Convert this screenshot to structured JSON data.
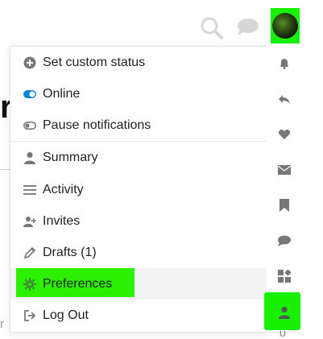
{
  "background": {
    "partial_heading": "r",
    "partial_text": "r"
  },
  "header": {
    "search_icon": "search-icon",
    "chat_icon": "chat-icon",
    "avatar_icon": "user-avatar"
  },
  "menu": {
    "status_items": [
      {
        "label": "Set custom status",
        "icon": "plus-circle-icon"
      },
      {
        "label": "Online",
        "icon": "toggle-on-icon"
      },
      {
        "label": "Pause notifications",
        "icon": "toggle-off-icon"
      }
    ],
    "nav_items": [
      {
        "label": "Summary",
        "icon": "user-icon"
      },
      {
        "label": "Activity",
        "icon": "list-icon"
      },
      {
        "label": "Invites",
        "icon": "user-plus-icon"
      },
      {
        "label": "Drafts (1)",
        "icon": "pencil-icon"
      },
      {
        "label": "Preferences",
        "icon": "gear-icon"
      },
      {
        "label": "Log Out",
        "icon": "sign-out-icon"
      }
    ]
  },
  "rail": [
    "bell-icon",
    "reply-icon",
    "heart-icon",
    "envelope-icon",
    "bookmark-icon",
    "comment-icon",
    "widgets-icon",
    "user-icon"
  ],
  "colors": {
    "highlight": "#2df000",
    "toggle_blue": "#0a86d8",
    "icon_gray": "#777777"
  },
  "counts": {
    "bottom_number": "0"
  }
}
